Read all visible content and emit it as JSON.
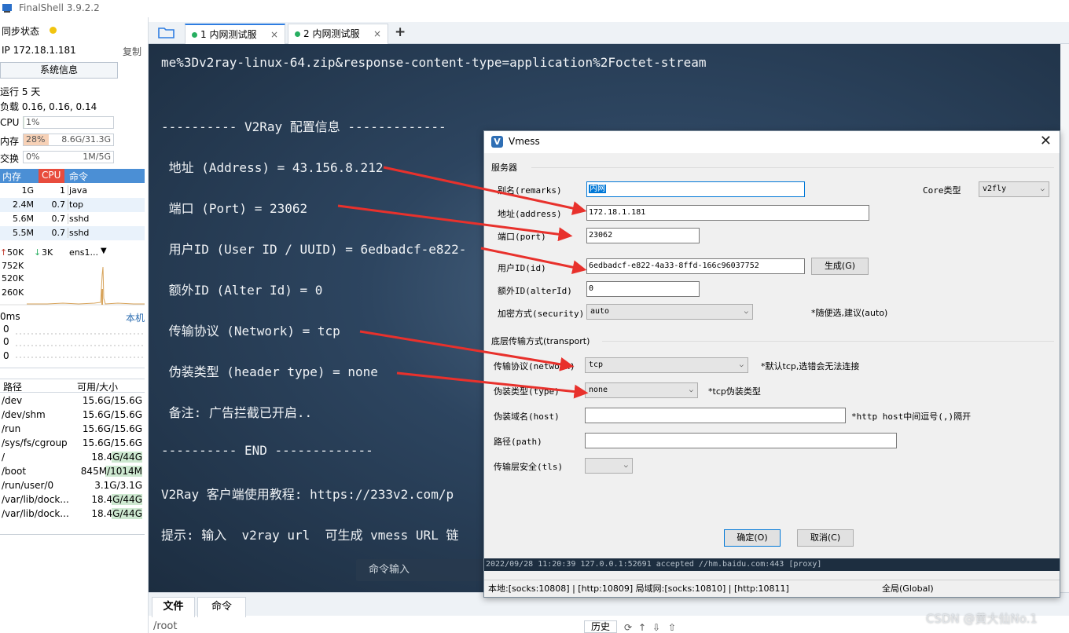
{
  "app": {
    "title": "FinalShell 3.9.2.2"
  },
  "sidebar": {
    "sync_label": "同步状态",
    "ip_label": "IP 172.18.1.181",
    "copy_label": "复制",
    "sysinfo_button": "系统信息",
    "uptime": "运行 5 天",
    "load": "负载 0.16, 0.16, 0.14",
    "cpu": {
      "label": "CPU",
      "value": "1%",
      "level": 0.01
    },
    "mem": {
      "label": "内存",
      "value": "28%",
      "detail": "8.6G/31.3G",
      "level": 0.28
    },
    "swap": {
      "label": "交换",
      "value": "0%",
      "detail": "1M/5G",
      "level": 0.0
    },
    "proc_headers": {
      "mem": "内存",
      "cpu": "CPU",
      "cmd": "命令"
    },
    "processes": [
      {
        "mem": "1G",
        "cpu": "1",
        "cmd": "java"
      },
      {
        "mem": "2.4M",
        "cpu": "0.7",
        "cmd": "top"
      },
      {
        "mem": "5.6M",
        "cpu": "0.7",
        "cmd": "sshd"
      },
      {
        "mem": "5.5M",
        "cpu": "0.7",
        "cmd": "sshd"
      }
    ],
    "net": {
      "up": "50K",
      "down": "3K",
      "iface": "ens1...",
      "y_ticks": [
        "752K",
        "520K",
        "260K"
      ]
    },
    "ping": {
      "label": "0ms",
      "host": "本机",
      "ticks": [
        "0",
        "0",
        "0"
      ]
    },
    "disk_headers": {
      "path": "路径",
      "size": "可用/大小"
    },
    "disks": [
      {
        "path": "/dev",
        "size": "15.6G/15.6G"
      },
      {
        "path": "/dev/shm",
        "size": "15.6G/15.6G"
      },
      {
        "path": "/run",
        "size": "15.6G/15.6G"
      },
      {
        "path": "/sys/fs/cgroup",
        "size": "15.6G/15.6G"
      },
      {
        "path": "/",
        "size": "18.4G/44G"
      },
      {
        "path": "/boot",
        "size": "845M/1014M"
      },
      {
        "path": "/run/user/0",
        "size": "3.1G/3.1G"
      },
      {
        "path": "/var/lib/dock...",
        "size": "18.4G/44G"
      },
      {
        "path": "/var/lib/dock...",
        "size": "18.4G/44G"
      }
    ]
  },
  "tabs": [
    {
      "label": "1 内网测试服",
      "close": "×"
    },
    {
      "label": "2 内网测试服",
      "close": "×"
    }
  ],
  "add_tab": "+",
  "terminal": {
    "lines": [
      "me%3Dv2ray-linux-64.zip&response-content-type=application%2Foctet-stream",
      "---------- V2Ray 配置信息 -------------",
      " 地址 (Address) = 43.156.8.212",
      " 端口 (Port) = 23062",
      " 用户ID (User ID / UUID) = 6edbadcf-e822-",
      " 额外ID (Alter Id) = 0",
      " 传输协议 (Network) = tcp",
      " 伪装类型 (header type) = none",
      " 备注: 广告拦截已开启..",
      "---------- END -------------",
      "V2Ray 客户端使用教程: https://233v2.com/p",
      "提示: 输入  v2ray url  可生成 vmess URL 链"
    ],
    "cmd_input_placeholder": "命令输入"
  },
  "bottom": {
    "tab_files": "文件",
    "tab_commands": "命令",
    "path": "/root",
    "history": "历史"
  },
  "dialog": {
    "title": "Vmess",
    "section_server": "服务器",
    "remarks_label": "别名(remarks)",
    "remarks_value": "内网",
    "core_label": "Core类型",
    "core_value": "v2fly",
    "address_label": "地址(address)",
    "address_value": "172.18.1.181",
    "port_label": "端口(port)",
    "port_value": "23062",
    "id_label": "用户ID(id)",
    "id_value": "6edbadcf-e822-4a33-8ffd-166c96037752",
    "generate_button": "生成(G)",
    "alter_label": "额外ID(alterId)",
    "alter_value": "0",
    "security_label": "加密方式(security)",
    "security_value": "auto",
    "security_hint": "*随便选,建议(auto)",
    "section_transport": "底层传输方式(transport)",
    "network_label": "传输协议(network)",
    "network_value": "tcp",
    "network_hint": "*默认tcp,选错会无法连接",
    "type_label": "伪装类型(type)",
    "type_value": "none",
    "type_hint": "*tcp伪装类型",
    "host_label": "伪装域名(host)",
    "host_value": "",
    "host_hint": "*http host中间逗号(,)隔开",
    "path_label": "路径(path)",
    "path_value": "",
    "tls_label": "传输层安全(tls)",
    "tls_value": "",
    "ok_button": "确定(O)",
    "cancel_button": "取消(C)",
    "log_line": "2022/09/28 11:20:39 127.0.0.1:52691 accepted //hm.baidu.com:443 [proxy]",
    "status_local": "本地:[socks:10808] | [http:10809]  局域网:[socks:10810] | [http:10811]",
    "status_mode": "全局(Global)"
  },
  "watermark": "CSDN @黄大仙No.1",
  "colors": {
    "arrow": "#e8312c",
    "accent": "#2e7de1",
    "terminal_bg": "#2d4560"
  }
}
